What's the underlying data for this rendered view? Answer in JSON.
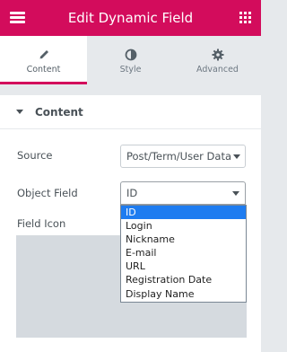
{
  "header": {
    "title": "Edit Dynamic Field",
    "accent": "#d30c5c"
  },
  "icons": {
    "menu": "hamburger-icon",
    "apps": "grid-apps-icon"
  },
  "tabs": [
    {
      "label": "Content",
      "icon": "pencil-icon",
      "active": true
    },
    {
      "label": "Style",
      "icon": "half-circle-icon",
      "active": false
    },
    {
      "label": "Advanced",
      "icon": "gear-icon",
      "active": false
    }
  ],
  "section": {
    "title": "Content"
  },
  "controls": {
    "source_label": "Source",
    "source_value": "Post/Term/User Data",
    "object_field_label": "Object Field",
    "object_field_value": "ID",
    "field_icon_label": "Field Icon"
  },
  "dropdown": {
    "options": [
      "ID",
      "Login",
      "Nickname",
      "E-mail",
      "URL",
      "Registration Date",
      "Display Name"
    ],
    "selected": "ID"
  }
}
